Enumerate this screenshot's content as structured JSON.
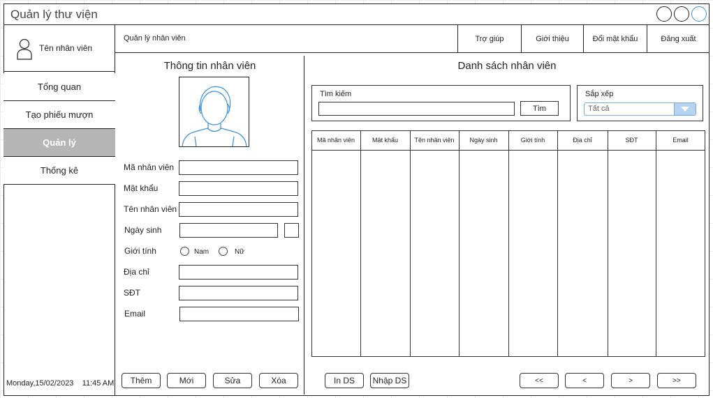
{
  "window": {
    "title": "Quản lý thư viện"
  },
  "sidebar": {
    "user_name": "Tên nhân viên",
    "items": [
      {
        "label": "Tổng quan"
      },
      {
        "label": "Tạo phiếu mượn"
      },
      {
        "label": "Quản lý",
        "active": true
      },
      {
        "label": "Thống kê"
      }
    ],
    "datetime": "Monday,15/02/2023    11:45 AM"
  },
  "topbar": {
    "page_label": "Quản lý nhân viên",
    "items": [
      {
        "label": "Trợ giúp"
      },
      {
        "label": "Giới thiệu"
      },
      {
        "label": "Đổi mật khẩu"
      },
      {
        "label": "Đăng xuất"
      }
    ]
  },
  "form": {
    "title": "Thông tin nhân viên",
    "fields": {
      "employee_id": {
        "label": "Mã nhân viên",
        "value": ""
      },
      "password": {
        "label": "Mật khẩu",
        "value": ""
      },
      "name": {
        "label": "Tên nhân viên",
        "value": ""
      },
      "birthdate": {
        "label": "Ngày sinh",
        "value": ""
      },
      "gender": {
        "label": "Giới tính",
        "options": [
          "Nam",
          "Nữ"
        ]
      },
      "address": {
        "label": "Địa chỉ",
        "value": ""
      },
      "phone": {
        "label": "SĐT",
        "value": ""
      },
      "email": {
        "label": "Email",
        "value": ""
      }
    },
    "buttons": {
      "add": "Thêm",
      "new": "Mới",
      "edit": "Sửa",
      "delete": "Xóa"
    }
  },
  "list": {
    "title": "Danh sách nhân viên",
    "search": {
      "label": "Tìm kiếm",
      "value": "",
      "button": "Tìm"
    },
    "sort": {
      "label": "Sắp xếp",
      "selected": "Tất cả"
    },
    "columns": [
      "Mã nhân viên",
      "Mật khẩu",
      "Tên nhân viên",
      "Ngày sinh",
      "Giới tính",
      "Địa chỉ",
      "SĐT",
      "Email"
    ],
    "rows": [],
    "buttons": {
      "print": "In DS",
      "import": "Nhập DS"
    },
    "pagination": {
      "first": "<<",
      "prev": "<",
      "next": ">",
      "last": ">>"
    }
  },
  "colors": {
    "active_bg": "#b5b5b5",
    "accent": "#3d8fd6",
    "border": "#222222"
  }
}
